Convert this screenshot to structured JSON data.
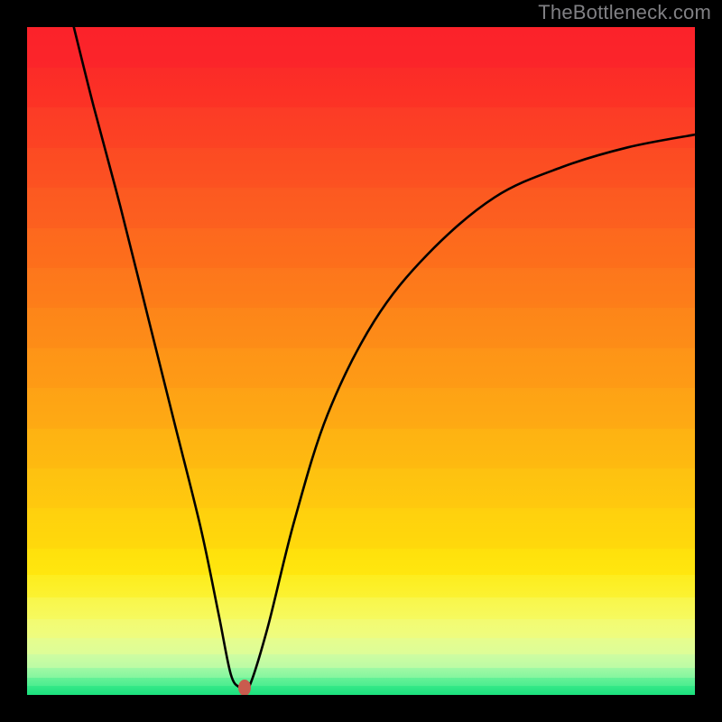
{
  "watermark": "TheBottleneck.com",
  "chart_data": {
    "type": "line",
    "title": "",
    "xlabel": "",
    "ylabel": "",
    "xlim": [
      0,
      100
    ],
    "ylim": [
      0,
      100
    ],
    "series": [
      {
        "name": "curve",
        "x": [
          7,
          10,
          14,
          18,
          22,
          26,
          28.7,
          30.5,
          31.9,
          33.2,
          36,
          40,
          45,
          52,
          60,
          70,
          80,
          90,
          100
        ],
        "y": [
          100,
          88,
          73,
          57,
          41,
          25,
          12,
          3.1,
          1.1,
          1.1,
          10,
          26,
          42,
          56,
          66,
          74.5,
          79,
          82,
          83.9
        ]
      }
    ],
    "marker": {
      "x": 32.6,
      "y": 1.1
    },
    "background_gradient": {
      "bands": [
        {
          "from": 0,
          "to": 6,
          "colors": [
            "#fb222a",
            "#fb252a"
          ]
        },
        {
          "from": 6,
          "to": 12,
          "colors": [
            "#fb2b28",
            "#fc3325"
          ]
        },
        {
          "from": 12,
          "to": 18,
          "colors": [
            "#fc3b26",
            "#fc4323"
          ]
        },
        {
          "from": 18,
          "to": 24,
          "colors": [
            "#fc4a23",
            "#fc5221"
          ]
        },
        {
          "from": 24,
          "to": 30,
          "colors": [
            "#fc5921",
            "#fc601f"
          ]
        },
        {
          "from": 30,
          "to": 36,
          "colors": [
            "#fd681e",
            "#fd6f1b"
          ]
        },
        {
          "from": 36,
          "to": 42,
          "colors": [
            "#fd761c",
            "#fd7e19"
          ]
        },
        {
          "from": 42,
          "to": 48,
          "colors": [
            "#fd8519",
            "#fd8d17"
          ]
        },
        {
          "from": 48,
          "to": 54,
          "colors": [
            "#fe9417",
            "#fe9b15"
          ]
        },
        {
          "from": 54,
          "to": 60,
          "colors": [
            "#fea215",
            "#feaa13"
          ]
        },
        {
          "from": 60,
          "to": 66,
          "colors": [
            "#feb212",
            "#feba10"
          ]
        },
        {
          "from": 66,
          "to": 72,
          "colors": [
            "#fec110",
            "#ffc90e"
          ]
        },
        {
          "from": 72,
          "to": 78,
          "colors": [
            "#ffd00d",
            "#ffd90c"
          ]
        },
        {
          "from": 78,
          "to": 82,
          "colors": [
            "#ffe00c",
            "#ffe70e"
          ]
        },
        {
          "from": 82,
          "to": 85.3,
          "colors": [
            "#fded1e",
            "#fbf232"
          ]
        },
        {
          "from": 85.3,
          "to": 88.6,
          "colors": [
            "#f9f649",
            "#f6fa5f"
          ]
        },
        {
          "from": 88.6,
          "to": 91.4,
          "colors": [
            "#f3fb70",
            "#eefc80"
          ]
        },
        {
          "from": 91.4,
          "to": 93.8,
          "colors": [
            "#e7fd8c",
            "#ddfd98"
          ]
        },
        {
          "from": 93.8,
          "to": 95.9,
          "colors": [
            "#cffca1",
            "#bcfba5"
          ]
        },
        {
          "from": 95.9,
          "to": 97.3,
          "colors": [
            "#a1f9a4",
            "#84f69f"
          ]
        },
        {
          "from": 97.3,
          "to": 98.6,
          "colors": [
            "#68f298",
            "#4ded90"
          ]
        },
        {
          "from": 98.6,
          "to": 100,
          "colors": [
            "#36e888",
            "#18e07c"
          ]
        }
      ]
    }
  }
}
